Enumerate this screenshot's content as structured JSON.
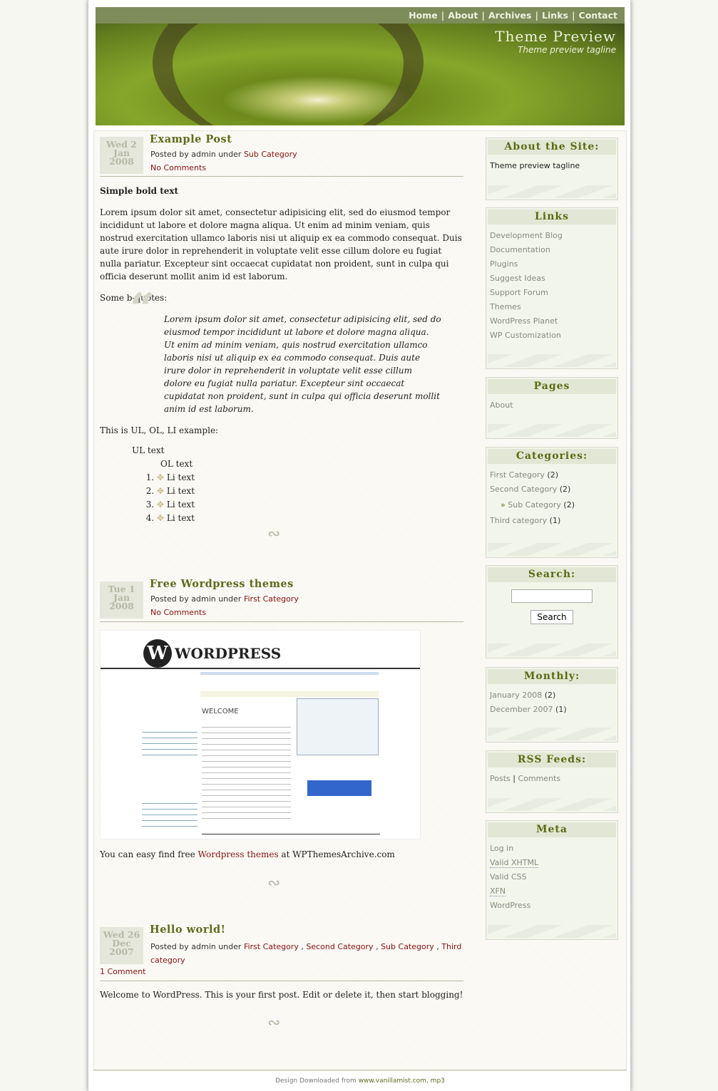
{
  "nav": [
    "Home",
    "About",
    "Archives",
    "Links",
    "Contact"
  ],
  "site": {
    "title": "Theme Preview",
    "tagline": "Theme preview tagline"
  },
  "posts": [
    {
      "date": [
        "Wed 2",
        "Jan",
        "2008"
      ],
      "title": "Example Post",
      "posted_by": "Posted by admin under",
      "categories": [
        "Sub Category"
      ],
      "comments": "No Comments",
      "heading": "Simple bold text",
      "para": "Lorem ipsum dolor sit amet, consectetur adipisicing elit, sed do eiusmod tempor incididunt ut labore et dolore magna aliqua. Ut enim ad minim veniam, quis nostrud exercitation ullamco laboris nisi ut aliquip ex ea commodo consequat. Duis aute irure dolor in reprehenderit in voluptate velit esse cillum dolore eu fugiat nulla pariatur. Excepteur sint occaecat cupidatat non proident, sunt in culpa qui officia deserunt mollit anim id est laborum.",
      "bq_label": "Some b-quotes:",
      "quote": "Lorem ipsum dolor sit amet, consectetur adipisicing elit, sed do eiusmod tempor incididunt ut labore et dolore magna aliqua. Ut enim ad minim veniam, quis nostrud exercitation ullamco laboris nisi ut aliquip ex ea commodo consequat. Duis aute irure dolor in reprehenderit in voluptate velit esse cillum dolore eu fugiat nulla pariatur. Excepteur sint occaecat cupidatat non proident, sunt in culpa qui officia deserunt mollit anim id est laborum.",
      "list_label": "This is UL, OL, LI example:",
      "ul_text": "UL text",
      "ol_text": "OL text",
      "li": [
        "Li text",
        "Li text",
        "Li text",
        "Li text"
      ]
    },
    {
      "date": [
        "Tue 1",
        "Jan",
        "2008"
      ],
      "title": "Free Wordpress themes",
      "posted_by": "Posted by admin under",
      "categories": [
        "First Category"
      ],
      "comments": "No Comments",
      "image_logo": "WORDPRESS",
      "image_welcome": "WELCOME",
      "text_before": "You can easy find free ",
      "link": "Wordpress themes",
      "text_after": " at WPThemesArchive.com"
    },
    {
      "date": [
        "Wed 26",
        "Dec",
        "2007"
      ],
      "title": "Hello world!",
      "posted_by": "Posted by admin under",
      "categories": [
        "First Category",
        "Second Category",
        "Sub Category",
        "Third category"
      ],
      "comments": "1 Comment",
      "text": "Welcome to WordPress. This is your first post. Edit or delete it, then start blogging!"
    }
  ],
  "sidebar": {
    "about": {
      "title": "About the Site:",
      "text": "Theme preview tagline"
    },
    "links": {
      "title": "Links",
      "items": [
        "Development Blog",
        "Documentation",
        "Plugins",
        "Suggest Ideas",
        "Support Forum",
        "Themes",
        "WordPress Planet",
        "WP Customization"
      ]
    },
    "pages": {
      "title": "Pages",
      "items": [
        "About"
      ]
    },
    "categories": {
      "title": "Categories:",
      "items": [
        {
          "label": "First Category",
          "count": "(2)"
        },
        {
          "label": "Second Category",
          "count": "(2)"
        },
        {
          "label": "Sub Category",
          "count": "(2)"
        },
        {
          "label": "Third category",
          "count": "(1)"
        }
      ]
    },
    "search": {
      "title": "Search:",
      "button": "Search",
      "value": ""
    },
    "monthly": {
      "title": "Monthly:",
      "items": [
        {
          "label": "January 2008",
          "count": "(2)"
        },
        {
          "label": "December 2007",
          "count": "(1)"
        }
      ]
    },
    "rss": {
      "title": "RSS Feeds:",
      "posts": "Posts",
      "sep": "|",
      "comments": "Comments"
    },
    "meta": {
      "title": "Meta",
      "items": [
        "Log in",
        "Valid XHTML",
        "Valid CSS",
        "XFN",
        "WordPress"
      ]
    }
  },
  "footer": {
    "text": "Design Downloaded from ",
    "link": "www.vanillamist.com",
    "sep": ", ",
    "link2": "mp3"
  },
  "colors": {
    "nav": "#7e8c5a",
    "title": "#5e6b1a",
    "link": "#8a1010",
    "widget_head": "#e1e7d4"
  }
}
